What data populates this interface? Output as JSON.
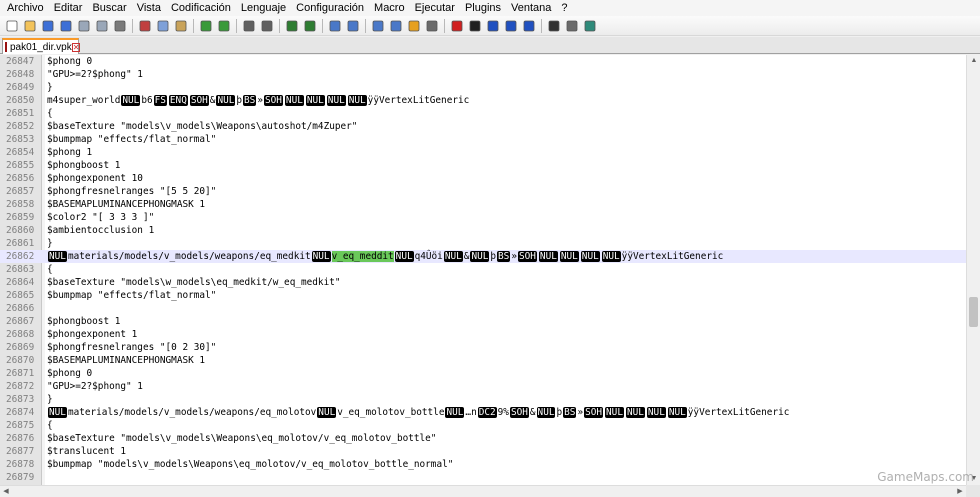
{
  "menu": [
    "Archivo",
    "Editar",
    "Buscar",
    "Vista",
    "Codificación",
    "Lenguaje",
    "Configuración",
    "Macro",
    "Ejecutar",
    "Plugins",
    "Ventana",
    "?"
  ],
  "toolbar": {
    "groups": [
      [
        "new-file",
        "open-file",
        "save",
        "save-all",
        "close",
        "close-all",
        "print"
      ],
      [
        "cut",
        "copy",
        "paste"
      ],
      [
        "undo",
        "redo"
      ],
      [
        "find",
        "replace"
      ],
      [
        "zoom-in",
        "zoom-out"
      ],
      [
        "sync-v",
        "sync-h"
      ],
      [
        "word-wrap",
        "all-chars",
        "indent-guide",
        "doc-map"
      ],
      [
        "record-macro",
        "stop-record",
        "play-macro",
        "play-multiple",
        "save-macro"
      ],
      [
        "function-list",
        "syntax",
        "spellcheck"
      ]
    ]
  },
  "tab": {
    "label": "pak01_dir.vpk",
    "close_glyph": "✕"
  },
  "watermark": "GameMaps.com",
  "lines": [
    {
      "n": "26847",
      "seg": [
        {
          "t": "$phong 0"
        }
      ]
    },
    {
      "n": "26848",
      "seg": [
        {
          "t": "\"GPU>=2?$phong\" 1"
        }
      ]
    },
    {
      "n": "26849",
      "seg": [
        {
          "t": "}"
        }
      ]
    },
    {
      "n": "26850",
      "seg": [
        {
          "t": "m4super_world"
        },
        {
          "c": "NUL"
        },
        {
          "t": "b6"
        },
        {
          "c": "FS"
        },
        {
          "c": "ENQ"
        },
        {
          "c": "SOH"
        },
        {
          "t": "&"
        },
        {
          "c": "NUL"
        },
        {
          "t": "þ"
        },
        {
          "c": "BS"
        },
        {
          "t": "»"
        },
        {
          "c": "SOH"
        },
        {
          "c": "NUL"
        },
        {
          "c": "NUL"
        },
        {
          "c": "NUL"
        },
        {
          "c": "NUL"
        },
        {
          "t": "ÿÿVertexLitGeneric"
        }
      ]
    },
    {
      "n": "26851",
      "seg": [
        {
          "t": "{"
        }
      ]
    },
    {
      "n": "26852",
      "seg": [
        {
          "t": "$baseTexture \"models\\v_models\\Weapons\\autoshot/m4Zuper\""
        }
      ]
    },
    {
      "n": "26853",
      "seg": [
        {
          "t": "$bumpmap \"effects/flat_normal\""
        }
      ]
    },
    {
      "n": "26854",
      "seg": [
        {
          "t": "$phong 1"
        }
      ]
    },
    {
      "n": "26855",
      "seg": [
        {
          "t": "$phongboost 1"
        }
      ]
    },
    {
      "n": "26856",
      "seg": [
        {
          "t": "$phongexponent 10"
        }
      ]
    },
    {
      "n": "26857",
      "seg": [
        {
          "t": "$phongfresnelranges \"[5 5 20]\""
        }
      ]
    },
    {
      "n": "26858",
      "seg": [
        {
          "t": "$BASEMAPLUMINANCEPHONGMASK 1"
        }
      ]
    },
    {
      "n": "26859",
      "seg": [
        {
          "t": "$color2 \"[ 3 3 3 ]\""
        }
      ]
    },
    {
      "n": "26860",
      "seg": [
        {
          "t": "$ambientocclusion 1"
        }
      ]
    },
    {
      "n": "26861",
      "seg": [
        {
          "t": "}"
        }
      ]
    },
    {
      "n": "26862",
      "current": true,
      "seg": [
        {
          "c": "NUL"
        },
        {
          "t": "materials/models/v_models/weapons/eq_medkit"
        },
        {
          "c": "NUL"
        },
        {
          "h": "v_eq_meddit"
        },
        {
          "c": "NUL"
        },
        {
          "t": "q4Ûöi"
        },
        {
          "c": "NUL"
        },
        {
          "t": "&"
        },
        {
          "c": "NUL"
        },
        {
          "t": "þ"
        },
        {
          "c": "BS"
        },
        {
          "t": "»"
        },
        {
          "c": "SOH"
        },
        {
          "c": "NUL"
        },
        {
          "c": "NUL"
        },
        {
          "c": "NUL"
        },
        {
          "c": "NUL"
        },
        {
          "t": "ÿÿVertexLitGeneric"
        }
      ]
    },
    {
      "n": "26863",
      "seg": [
        {
          "t": "{"
        }
      ]
    },
    {
      "n": "26864",
      "seg": [
        {
          "t": "$baseTexture \"models\\w_models\\eq_medkit/w_eq_medkit\""
        }
      ]
    },
    {
      "n": "26865",
      "seg": [
        {
          "t": "$bumpmap \"effects/flat_normal\""
        }
      ]
    },
    {
      "n": "26866",
      "seg": [
        {
          "t": ""
        }
      ]
    },
    {
      "n": "26867",
      "seg": [
        {
          "t": "$phongboost 1"
        }
      ]
    },
    {
      "n": "26868",
      "seg": [
        {
          "t": "$phongexponent 1"
        }
      ]
    },
    {
      "n": "26869",
      "seg": [
        {
          "t": "$phongfresnelranges \"[0 2 30]\""
        }
      ]
    },
    {
      "n": "26870",
      "seg": [
        {
          "t": "$BASEMAPLUMINANCEPHONGMASK 1"
        }
      ]
    },
    {
      "n": "26871",
      "seg": [
        {
          "t": "$phong 0"
        }
      ]
    },
    {
      "n": "26872",
      "seg": [
        {
          "t": "\"GPU>=2?$phong\" 1"
        }
      ]
    },
    {
      "n": "26873",
      "seg": [
        {
          "t": "}"
        }
      ]
    },
    {
      "n": "26874",
      "seg": [
        {
          "c": "NUL"
        },
        {
          "t": "materials/models/v_models/weapons/eq_molotov"
        },
        {
          "c": "NUL"
        },
        {
          "t": "v_eq_molotov_bottle"
        },
        {
          "c": "NUL"
        },
        {
          "t": "…n"
        },
        {
          "c": "DC2"
        },
        {
          "t": "9%"
        },
        {
          "c": "SOH"
        },
        {
          "t": "&"
        },
        {
          "c": "NUL"
        },
        {
          "t": "þ"
        },
        {
          "c": "BS"
        },
        {
          "t": "»"
        },
        {
          "c": "SOH"
        },
        {
          "c": "NUL"
        },
        {
          "c": "NUL"
        },
        {
          "c": "NUL"
        },
        {
          "c": "NUL"
        },
        {
          "t": "ÿÿVertexLitGeneric"
        }
      ]
    },
    {
      "n": "26875",
      "seg": [
        {
          "t": "{"
        }
      ]
    },
    {
      "n": "26876",
      "seg": [
        {
          "t": "$baseTexture \"models\\v_models\\Weapons\\eq_molotov/v_eq_molotov_bottle\""
        }
      ]
    },
    {
      "n": "26877",
      "seg": [
        {
          "t": "$translucent 1"
        }
      ]
    },
    {
      "n": "26878",
      "seg": [
        {
          "t": "$bumpmap \"models\\v_models\\Weapons\\eq_molotov/v_eq_molotov_bottle_normal\""
        }
      ]
    },
    {
      "n": "26879",
      "seg": [
        {
          "t": ""
        }
      ]
    }
  ]
}
